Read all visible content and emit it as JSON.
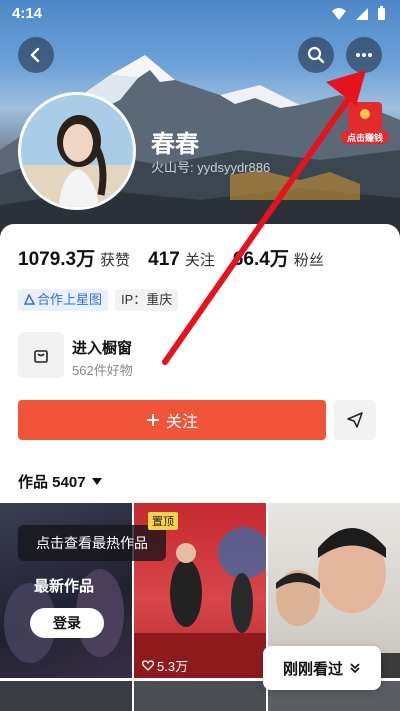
{
  "status_bar": {
    "time": "4:14"
  },
  "header": {
    "back_icon": "chevron-left-icon",
    "search_icon": "search-icon",
    "more_icon": "more-dots-icon"
  },
  "profile": {
    "name": "春春",
    "handle": "火山号: yydsyydr886",
    "envelope_label": "点击赚钱"
  },
  "stats": [
    {
      "value": "1079.3万",
      "label": "获赞"
    },
    {
      "value": "417",
      "label": "关注"
    },
    {
      "value": "66.4万",
      "label": "粉丝"
    }
  ],
  "tags": {
    "coop": "合作上星图",
    "ip": "IP：重庆"
  },
  "shop": {
    "title": "进入橱窗",
    "subtitle": "562件好物"
  },
  "actions": {
    "follow": "关注"
  },
  "works": {
    "label": "作品 5407"
  },
  "grid": {
    "hint": "点击查看最热作品",
    "latest": "最新作品",
    "login": "登录",
    "pinned": "置顶",
    "likes": "5.3万",
    "recent": "刚刚看过"
  },
  "accent": "#f0553a",
  "annotation_color": "#e6121d"
}
